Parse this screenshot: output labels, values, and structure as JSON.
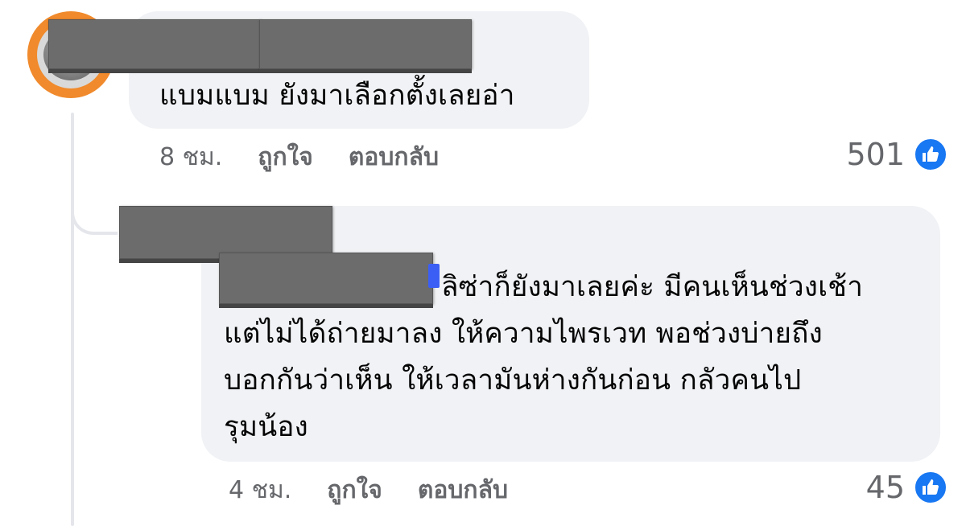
{
  "comments": [
    {
      "text": "แบมแบม ยังมาเลือกตั้งเลยอ่า",
      "time": "8 ชม.",
      "like_label": "ถูกใจ",
      "reply_label": "ตอบกลับ",
      "reaction_count": "501",
      "reaction_icon": "like-icon"
    },
    {
      "text": "ลิซ่าก็ยังมาเลยค่ะ มีคนเห็นช่วงเช้า\nแต่ไม่ได้ถ่ายมาลง ให้ความไพรเวท พอช่วงบ่ายถึง\nบอกกันว่าเห็น ให้เวลามันห่างกันก่อน กลัวคนไป\nรุมน้อง",
      "time": "4 ชม.",
      "like_label": "ถูกใจ",
      "reply_label": "ตอบกลับ",
      "reaction_count": "45",
      "reaction_icon": "like-icon"
    }
  ],
  "colors": {
    "bubble": "#f0f2f5",
    "meta_text": "#65676b",
    "like_blue": "#1877f2",
    "avatar_ring": "#f08a2c",
    "redaction": "#6c6c6c"
  }
}
